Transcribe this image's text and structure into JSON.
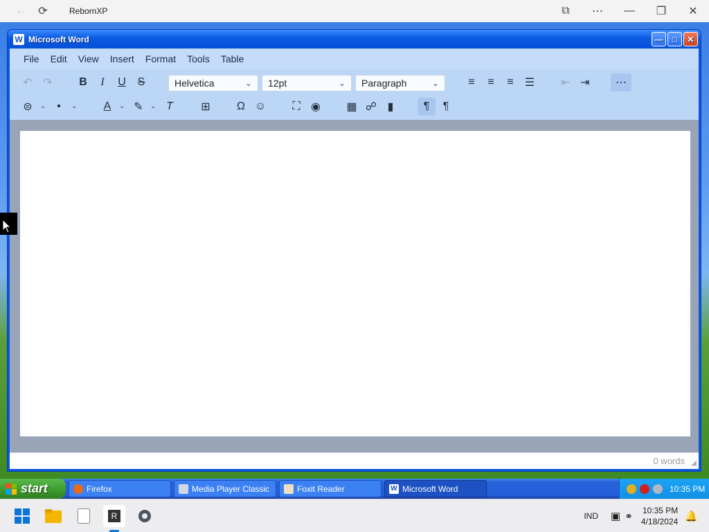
{
  "host": {
    "title": "RebornXP"
  },
  "window": {
    "title": "Microsoft Word"
  },
  "menu": [
    "File",
    "Edit",
    "View",
    "Insert",
    "Format",
    "Tools",
    "Table"
  ],
  "toolbar": {
    "font": "Helvetica",
    "size": "12pt",
    "block": "Paragraph",
    "row1_icons": [
      "undo-icon",
      "redo-icon",
      "bold-icon",
      "italic-icon",
      "underline-icon",
      "strikethrough-icon",
      "align-left-icon",
      "align-center-icon",
      "align-right-icon",
      "justify-icon",
      "outdent-icon",
      "indent-icon",
      "more-icon"
    ],
    "row2_icons": [
      "numbered-list-icon",
      "bullet-list-icon",
      "text-color-icon",
      "highlight-icon",
      "clear-format-icon",
      "page-break-icon",
      "special-char-icon",
      "emoji-icon",
      "fullscreen-icon",
      "preview-icon",
      "image-icon",
      "link-icon",
      "bookmark-icon",
      "ltr-icon",
      "rtl-icon"
    ]
  },
  "status": {
    "words": "0 words"
  },
  "xp_taskbar": {
    "start": "start",
    "tasks": [
      "Firefox",
      "Media Player Classic",
      "Foxit Reader",
      "Microsoft Word"
    ],
    "time": "10:35 PM"
  },
  "win11_taskbar": {
    "lang": "IND",
    "time": "10:35 PM",
    "date": "4/18/2024"
  }
}
